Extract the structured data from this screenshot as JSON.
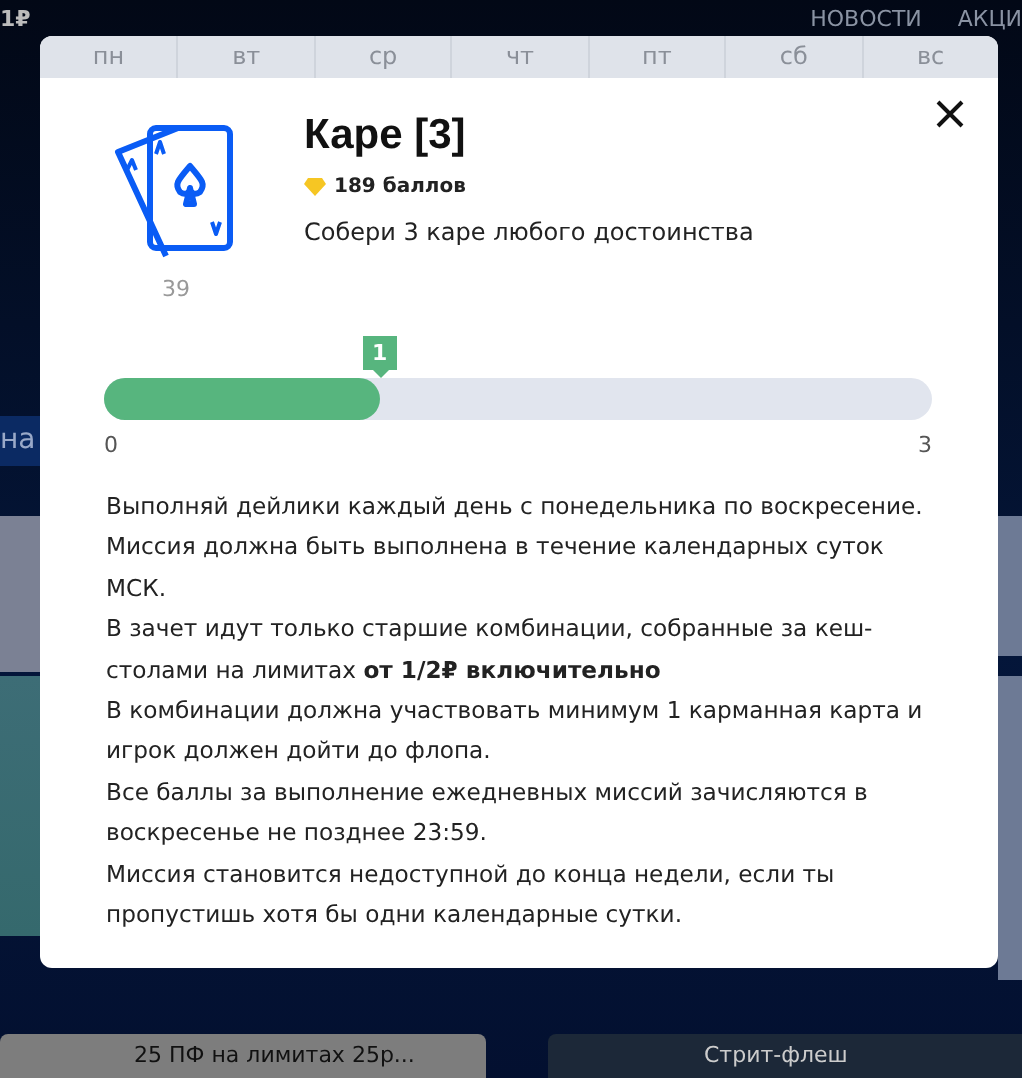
{
  "top_bar": {
    "balance": "1₽",
    "nav": [
      "НОВОСТИ",
      "АКЦИ"
    ]
  },
  "background": {
    "partial_label": "на",
    "cards": [
      {
        "title": "25 ПФ на лимитах 25р...",
        "kind": "grey"
      },
      {
        "title": "Стрит-флеш",
        "kind": "dark"
      }
    ]
  },
  "modal": {
    "weekdays": [
      "пн",
      "вт",
      "ср",
      "чт",
      "пт",
      "сб",
      "вс"
    ],
    "icon_count": "39",
    "title": "Каре [3]",
    "points": "189 баллов",
    "description": "Собери 3 каре любого достоинства",
    "progress": {
      "level": 0.333,
      "marker": "1",
      "min": "0",
      "max": "3"
    },
    "rules": [
      "Выполняй дейлики каждый день с понедельника по воскресение.",
      "Миссия должна быть выполнена в течение календарных суток МСК.",
      "В зачет идут только старшие комбинации, собранные за кеш-столами на лимитах **от 1/2₽ включительно**",
      "В комбинации должна участвовать минимум 1 карманная карта и игрок должен дойти до флопа.",
      "Все баллы за выполнение ежедневных миссий зачисляются в воскресенье не позднее 23:59.",
      "Миссия становится недоступной до конца недели, если ты пропустишь хотя бы одни календарные сутки."
    ]
  }
}
